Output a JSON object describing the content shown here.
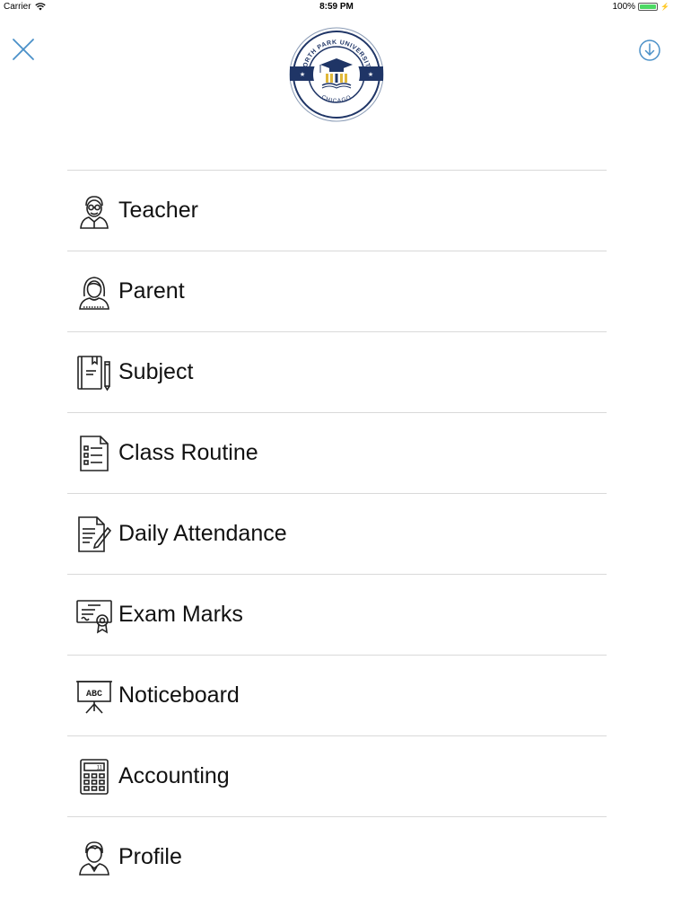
{
  "status_bar": {
    "carrier": "Carrier",
    "time": "8:59 PM",
    "battery": "100%"
  },
  "header": {
    "logo": {
      "top_text": "NORTH PARK UNIVERSITY",
      "bottom_text": "CHICAGO",
      "icon": "graduation-cap-icon"
    },
    "close_icon": "close-icon",
    "download_icon": "download-icon"
  },
  "menu": {
    "items": [
      {
        "label": "Teacher",
        "icon": "teacher-icon"
      },
      {
        "label": "Parent",
        "icon": "parent-icon"
      },
      {
        "label": "Subject",
        "icon": "book-icon"
      },
      {
        "label": "Class Routine",
        "icon": "routine-icon"
      },
      {
        "label": "Daily Attendance",
        "icon": "attendance-icon"
      },
      {
        "label": "Exam Marks",
        "icon": "certificate-icon"
      },
      {
        "label": "Noticeboard",
        "icon": "noticeboard-icon"
      },
      {
        "label": "Accounting",
        "icon": "calculator-icon"
      },
      {
        "label": "Profile",
        "icon": "profile-icon"
      }
    ]
  },
  "colors": {
    "accent": "#4a90c8",
    "navy": "#1f3566",
    "gold": "#e0b83a",
    "divider": "#d9d9d9"
  }
}
